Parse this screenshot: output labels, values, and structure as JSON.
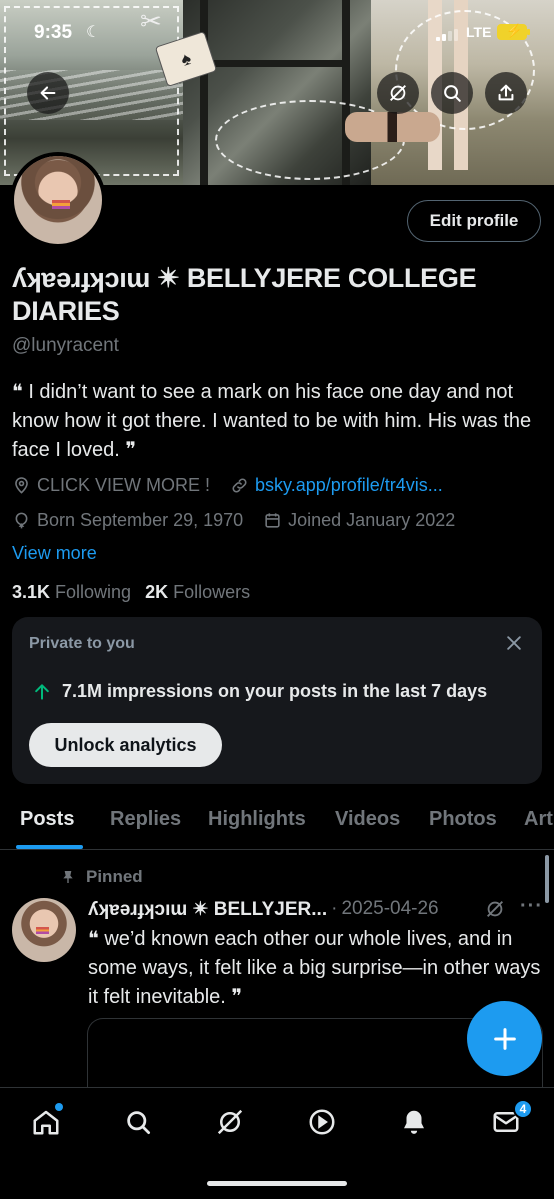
{
  "status_bar": {
    "time": "9:35",
    "network": "LTE"
  },
  "banner": {
    "back_icon": "arrow-left-icon",
    "grok_icon": "grok-icon",
    "search_icon": "search-icon",
    "share_icon": "share-icon"
  },
  "profile": {
    "edit_label": "Edit profile",
    "display_name": "ʎʞɐǝɹɟʞɔıɯ ✴ BELLYJERE COLLEGE DIARIES",
    "handle": "@lunyracent",
    "bio": "❝ I didn’t want to see a mark on his face one day and not know how it got there. I wanted to be with him. His was the face I loved. ❞",
    "location": "CLICK VIEW MORE !",
    "website": "bsky.app/profile/tr4vis...",
    "birth": "Born September 29, 1970",
    "joined": "Joined January 2022",
    "view_more": "View more",
    "following_count": "3.1K",
    "following_label": "Following",
    "followers_count": "2K",
    "followers_label": "Followers"
  },
  "analytics_card": {
    "label": "Private to you",
    "stat": "7.1M impressions on your posts in the last 7 days",
    "button": "Unlock analytics"
  },
  "tabs": [
    "Posts",
    "Replies",
    "Highlights",
    "Videos",
    "Photos",
    "Art"
  ],
  "active_tab": "Posts",
  "post": {
    "pinned_label": "Pinned",
    "author": "ʎʞɐǝɹɟʞɔıɯ ✴ BELLYJER...",
    "separator": "·",
    "date": "2025-04-26",
    "more": "···",
    "text": "❝ we’d known each other our whole lives, and in some ways, it felt like a big surprise—in other ways it felt inevitable. ❞"
  },
  "bottom_nav": {
    "items": [
      "home-icon",
      "search-icon",
      "grok-icon",
      "video-icon",
      "notifications-icon",
      "messages-icon"
    ],
    "messages_badge": "4"
  },
  "colors": {
    "accent": "#1d9bf0",
    "background": "#000000",
    "secondary_text": "#71767b",
    "card_background": "#16181c"
  }
}
